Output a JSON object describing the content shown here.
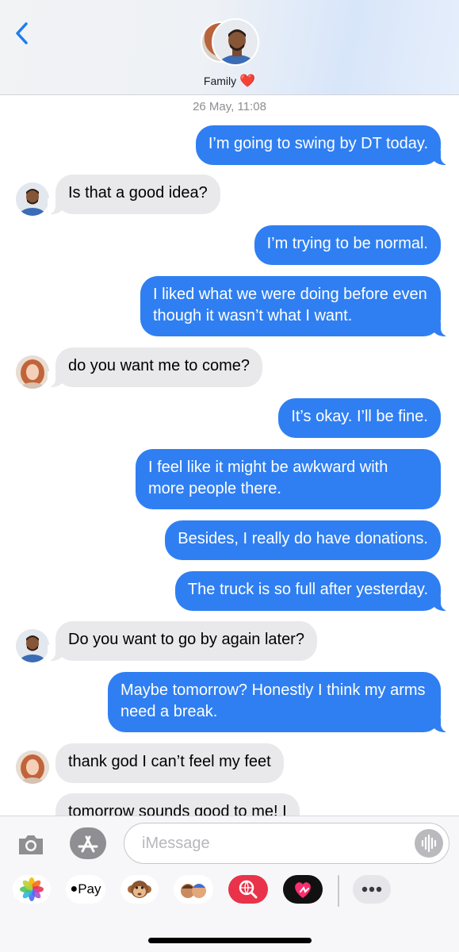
{
  "header": {
    "back_label": "Back",
    "group_name": "Family",
    "group_emoji": "❤️"
  },
  "timestamp": "26 May, 11:08",
  "messages": [
    {
      "side": "sent",
      "sender": "me",
      "text": "I’m going to swing by DT today."
    },
    {
      "side": "received",
      "sender": "man",
      "text": "Is that a good idea?"
    },
    {
      "side": "sent",
      "sender": "me",
      "text": "I’m trying to be normal."
    },
    {
      "side": "sent",
      "sender": "me",
      "text": "I liked what we were doing before even though it wasn’t what I want."
    },
    {
      "side": "received",
      "sender": "woman",
      "text": "do you want me to come?"
    },
    {
      "side": "sent",
      "sender": "me",
      "text": "It’s okay. I’ll be fine."
    },
    {
      "side": "sent",
      "sender": "me",
      "text": "I feel like it might be awkward with more people there."
    },
    {
      "side": "sent",
      "sender": "me",
      "text": "Besides, I really do have donations."
    },
    {
      "side": "sent",
      "sender": "me",
      "text": "The truck is so full after yesterday."
    },
    {
      "side": "received",
      "sender": "man",
      "text": "Do you want to go by again later?"
    },
    {
      "side": "sent",
      "sender": "me",
      "text": "Maybe tomorrow? Honestly I think my arms need a break."
    },
    {
      "side": "received",
      "sender": "woman",
      "text": "thank god I can’t feel my feet"
    },
    {
      "side": "received",
      "sender": "woman",
      "text": "tomorrow sounds good to me! I"
    }
  ],
  "composer": {
    "placeholder": "iMessage"
  },
  "app_drawer": {
    "items": [
      {
        "name": "photos-app-icon"
      },
      {
        "name": "apple-pay-app-icon",
        "label": "Pay"
      },
      {
        "name": "animoji-app-icon"
      },
      {
        "name": "memoji-stickers-app-icon"
      },
      {
        "name": "web-image-search-app-icon"
      },
      {
        "name": "digital-touch-app-icon"
      },
      {
        "name": "more-apps-icon"
      }
    ]
  },
  "colors": {
    "sent_bubble": "#2f7ff2",
    "received_bubble": "#e9e9eb",
    "accent": "#1f7cf0"
  }
}
